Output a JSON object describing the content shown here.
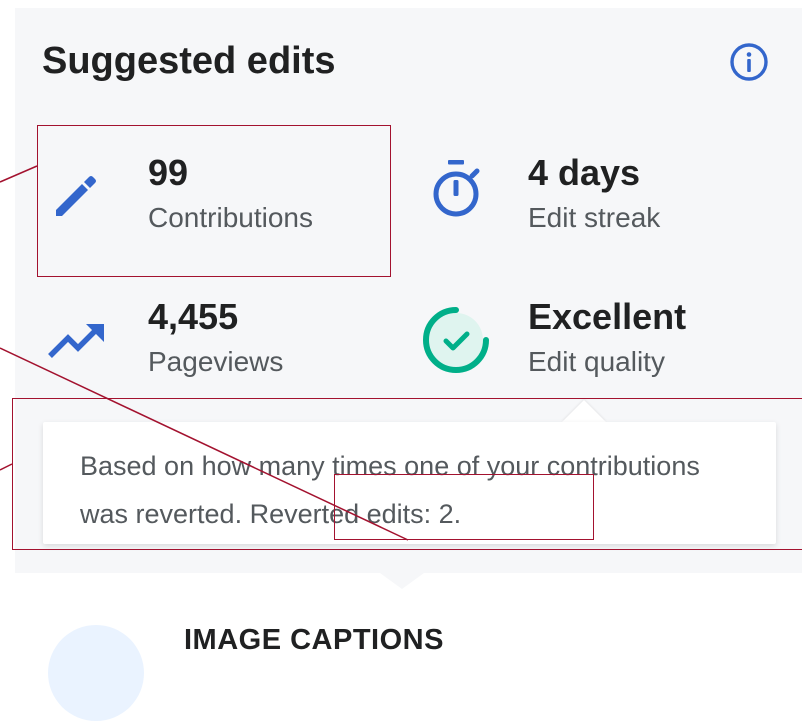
{
  "header": {
    "title": "Suggested edits",
    "info_icon": "info-icon"
  },
  "stats": [
    {
      "icon": "pencil-icon",
      "value": "99",
      "label": "Contributions",
      "color": "#3366cc"
    },
    {
      "icon": "stopwatch-icon",
      "value": "4 days",
      "label": "Edit streak",
      "color": "#3366cc"
    },
    {
      "icon": "trending-up-icon",
      "value": "4,455",
      "label": "Pageviews",
      "color": "#3366cc"
    },
    {
      "icon": "check-circle-icon",
      "value": "Excellent",
      "label": "Edit quality",
      "color": "#00af89"
    }
  ],
  "tooltip": {
    "text": "Based on how many times one of your contributions was reverted. Reverted edits: 2."
  },
  "next_section": {
    "title": "IMAGE CAPTIONS"
  },
  "colors": {
    "accent": "#3366cc",
    "success": "#00af89",
    "annotation": "#a3122f",
    "card_background": "#f6f7f9"
  }
}
